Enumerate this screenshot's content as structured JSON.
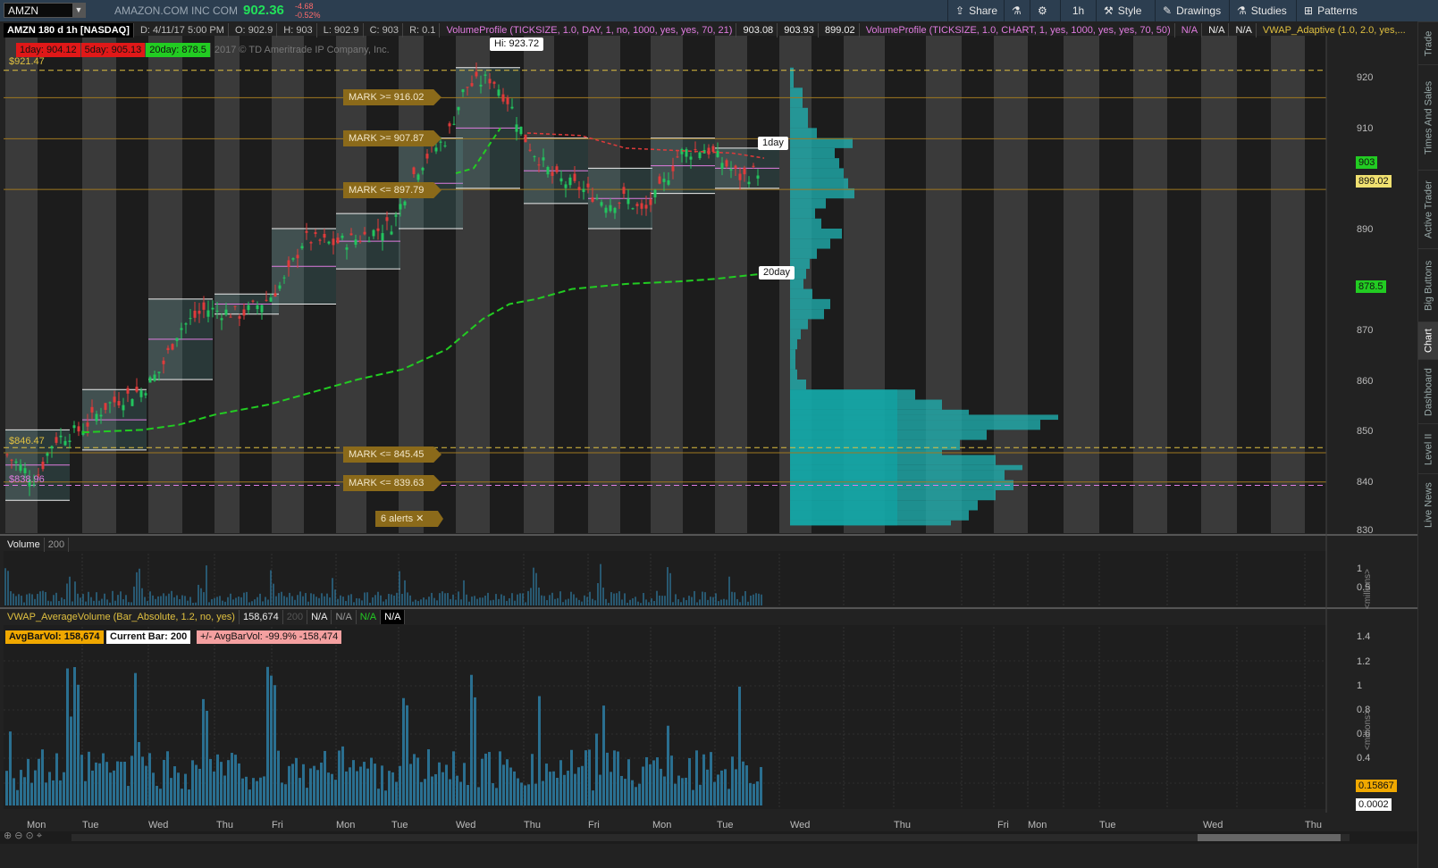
{
  "topbar": {
    "symbol": "AMZN",
    "company": "AMAZON.COM INC COM",
    "last": "902.36",
    "change": "-4.68",
    "change_pct": "-0.52%",
    "buttons": [
      {
        "label": "Share",
        "icon": "share-icon"
      },
      {
        "label": "",
        "icon": "flask-icon"
      },
      {
        "label": "",
        "icon": "gear-icon"
      },
      {
        "label": "1h",
        "icon": ""
      },
      {
        "label": "Style",
        "icon": "style-icon"
      },
      {
        "label": "Drawings",
        "icon": "pencil-icon"
      },
      {
        "label": "Studies",
        "icon": "flask-icon"
      },
      {
        "label": "Patterns",
        "icon": "patterns-icon"
      }
    ]
  },
  "right_tabs": [
    "Trade",
    "Times And Sales",
    "Active Trader",
    "Big Buttons",
    "Chart",
    "Dashboard",
    "Level II",
    "Live News"
  ],
  "info": {
    "title": "AMZN 180 d 1h [NASDAQ]",
    "date": "D: 4/11/17 5:00 PM",
    "open": "O: 902.9",
    "high": "H: 903",
    "low": "L: 902.9",
    "close": "C: 903",
    "range": "R: 0.1",
    "vp1": "VolumeProfile (TICKSIZE, 1.0, DAY, 1, no, 1000, yes, yes, 70, 21)",
    "vp1_v1": "903.08",
    "vp1_v2": "903.93",
    "vp1_v3": "899.02",
    "vp2": "VolumeProfile (TICKSIZE, 1.0, CHART, 1, yes, 1000, yes, yes, 70, 50)",
    "na1": "N/A",
    "na2": "N/A",
    "na3": "N/A",
    "vwap": "VWAP_Adaptive (1.0, 2.0, yes,...",
    "d1": "1day: 904.12",
    "d5": "5day: 905.13",
    "d20": "20day: 878.5",
    "copyright": "2017 © TD Ameritrade IP Company, Inc."
  },
  "price_axis": {
    "ticks": [
      "920",
      "910",
      "900",
      "890",
      "880",
      "870",
      "860",
      "850",
      "840",
      "830"
    ],
    "badge_903": "903",
    "badge_899": "899.02",
    "badge_878": "878.5"
  },
  "callouts": {
    "hi": "Hi: 923.72",
    "oneday": "1day",
    "twentyday": "20day",
    "p92147": "$921.47",
    "p84647": "$846.47",
    "p83896": "$838.96"
  },
  "marks": [
    {
      "label": "MARK >= 916.02"
    },
    {
      "label": "MARK >= 907.87"
    },
    {
      "label": "MARK <= 897.79"
    },
    {
      "label": "MARK <= 845.45"
    },
    {
      "label": "MARK <= 839.63"
    },
    {
      "label": "6 alerts"
    }
  ],
  "volume_panel": {
    "title": "Volume",
    "value": "200",
    "ticks": [
      "1",
      "0.5"
    ],
    "unit": "<millions>"
  },
  "vwap_panel": {
    "title": "VWAP_AverageVolume (Bar_Absolute, 1.2, no, yes)",
    "v1": "158,674",
    "v2": "200",
    "na1": "N/A",
    "na2": "N/A",
    "na3": "N/A",
    "na4": "N/A",
    "avg_label": "AvgBarVol: 158,674",
    "cur_label": "Current Bar: 200",
    "diff_label": "+/- AvgBarVol:  -99.9%  -158,474",
    "ticks": [
      "1.4",
      "1.2",
      "1",
      "0.8",
      "0.6",
      "0.4"
    ],
    "unit": "<millions>",
    "badge1": "0.15867",
    "badge2": "0.0002"
  },
  "x_axis": [
    "Mon",
    "Tue",
    "Wed",
    "Thu",
    "Fri",
    "Mon",
    "Tue",
    "Wed",
    "Thu",
    "Fri",
    "Mon",
    "Tue",
    "Wed",
    "Thu",
    "Fri",
    "Mon",
    "Tue",
    "Wed",
    "Thu"
  ],
  "colors": {
    "up": "#22c55e",
    "down": "#e03a3a",
    "profile": "#1fb5b5",
    "ma20": "#22cc22",
    "gold": "#c8a038"
  }
}
